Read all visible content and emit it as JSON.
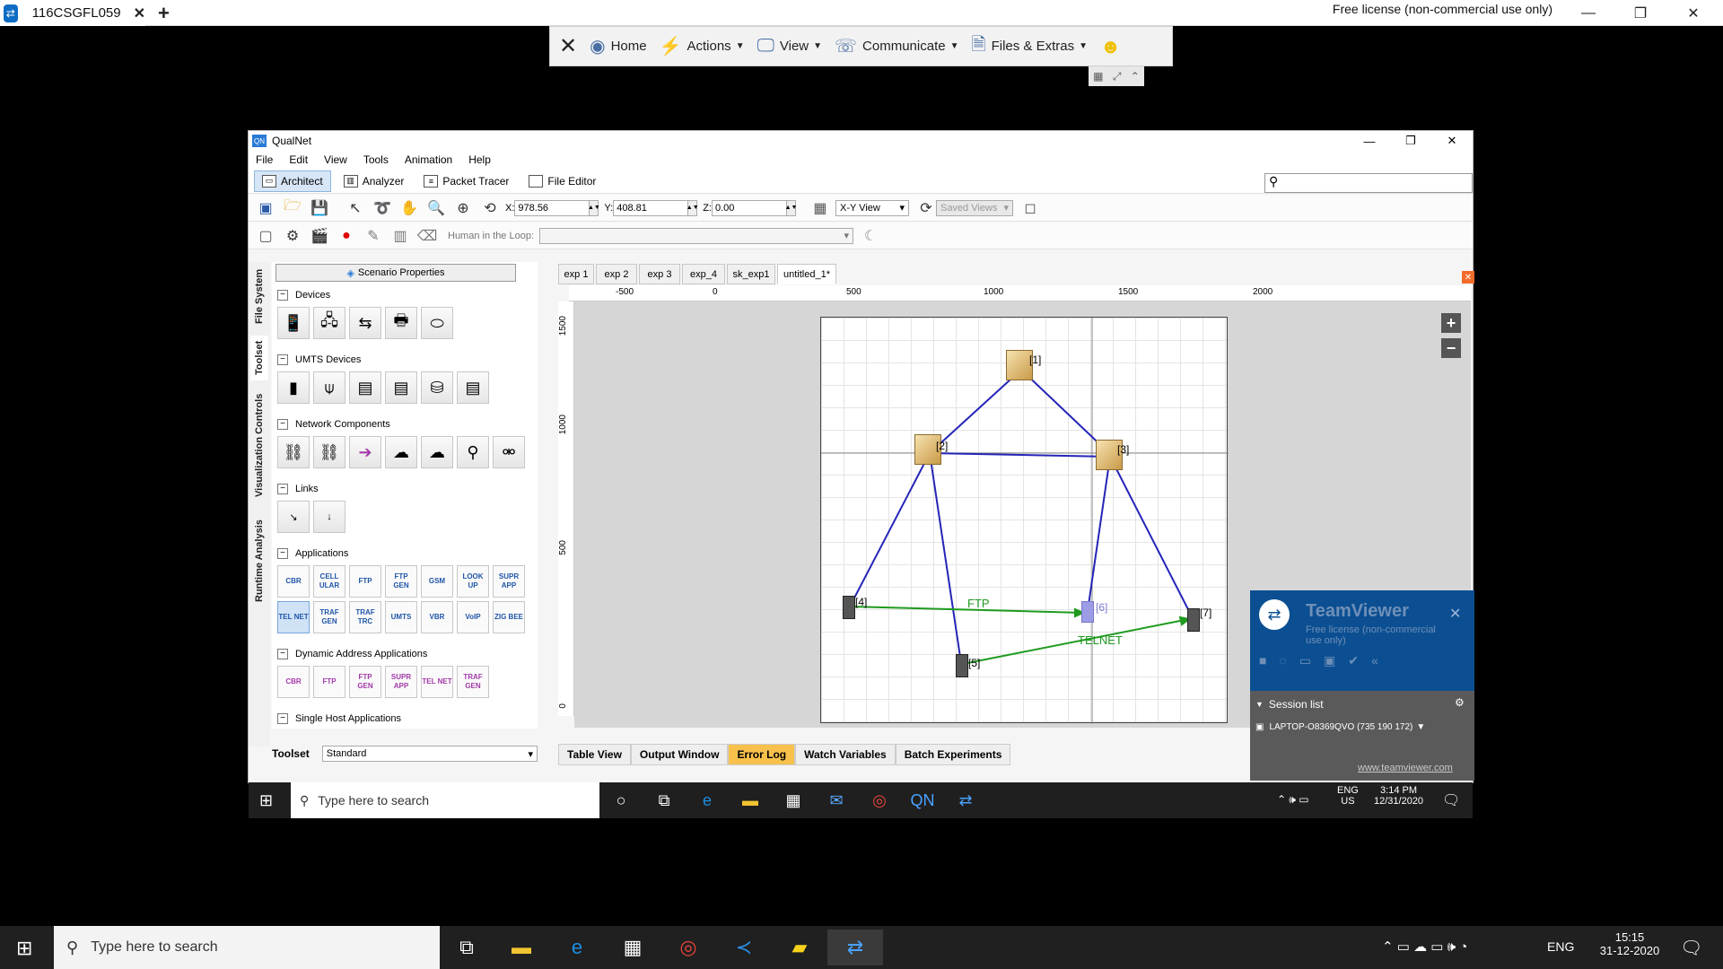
{
  "host": {
    "tab_label": "116CSGFL059",
    "license_text": "Free license (non-commercial use only)",
    "toolbar": {
      "home": "Home",
      "actions": "Actions",
      "view": "View",
      "communicate": "Communicate",
      "files": "Files & Extras"
    }
  },
  "qualnet": {
    "title": "QualNet",
    "menu": [
      "File",
      "Edit",
      "View",
      "Tools",
      "Animation",
      "Help"
    ],
    "modes": [
      "Architect",
      "Analyzer",
      "Packet Tracer",
      "File Editor"
    ],
    "coords": {
      "x_label": "X:",
      "x": "978.56",
      "y_label": "Y:",
      "y": "408.81",
      "z_label": "Z:",
      "z": "0.00"
    },
    "view_select": "X-Y View",
    "saved_views": "Saved Views",
    "hitl_label": "Human in the Loop:",
    "side_tabs": [
      "File System",
      "Toolset",
      "Visualization Controls",
      "Runtime Analysis"
    ],
    "scenario_button": "Scenario Properties",
    "sections": {
      "devices": "Devices",
      "umts": "UMTS Devices",
      "network": "Network Components",
      "links": "Links",
      "applications": "Applications",
      "dynamic": "Dynamic Address Applications",
      "single": "Single Host Applications"
    },
    "apps": [
      "CBR",
      "CELL ULAR",
      "FTP",
      "FTP GEN",
      "GSM",
      "LOOK UP",
      "SUPR APP",
      "TEL NET",
      "TRAF GEN",
      "TRAF TRC",
      "UMTS",
      "VBR",
      "VoIP",
      "ZIG BEE"
    ],
    "dyn_apps": [
      "CBR",
      "FTP",
      "FTP GEN",
      "SUPR APP",
      "TEL NET",
      "TRAF GEN"
    ],
    "toolset_label": "Toolset",
    "toolset_value": "Standard",
    "editor_tabs": [
      "exp 1",
      "exp 2",
      "exp 3",
      "exp_4",
      "sk_exp1",
      "untitled_1*"
    ],
    "ruler_top": [
      "-500",
      "0",
      "500",
      "1000",
      "1500",
      "2000"
    ],
    "ruler_left": [
      "1500",
      "1000",
      "500",
      "0"
    ],
    "nodes": [
      "[1]",
      "[2]",
      "[3]",
      "[4]",
      "[5]",
      "[6]",
      "[7]"
    ],
    "link_labels": {
      "ftp": "FTP",
      "telnet": "TELNET"
    },
    "bottom_tabs": [
      "Table View",
      "Output Window",
      "Error Log",
      "Watch Variables",
      "Batch Experiments"
    ]
  },
  "teamviewer_popup": {
    "title": "TeamViewer",
    "license": "Free license (non-commercial use only)",
    "session_list": "Session list",
    "session_entry": "LAPTOP-O8369QVO (735 190 172)",
    "url": "www.teamviewer.com"
  },
  "remote_taskbar": {
    "search": "Type here to search",
    "lang": "ENG",
    "region": "US",
    "time": "3:14 PM",
    "date": "12/31/2020"
  },
  "local_taskbar": {
    "search": "Type here to search",
    "lang": "ENG",
    "time": "15:15",
    "date": "31-12-2020"
  }
}
